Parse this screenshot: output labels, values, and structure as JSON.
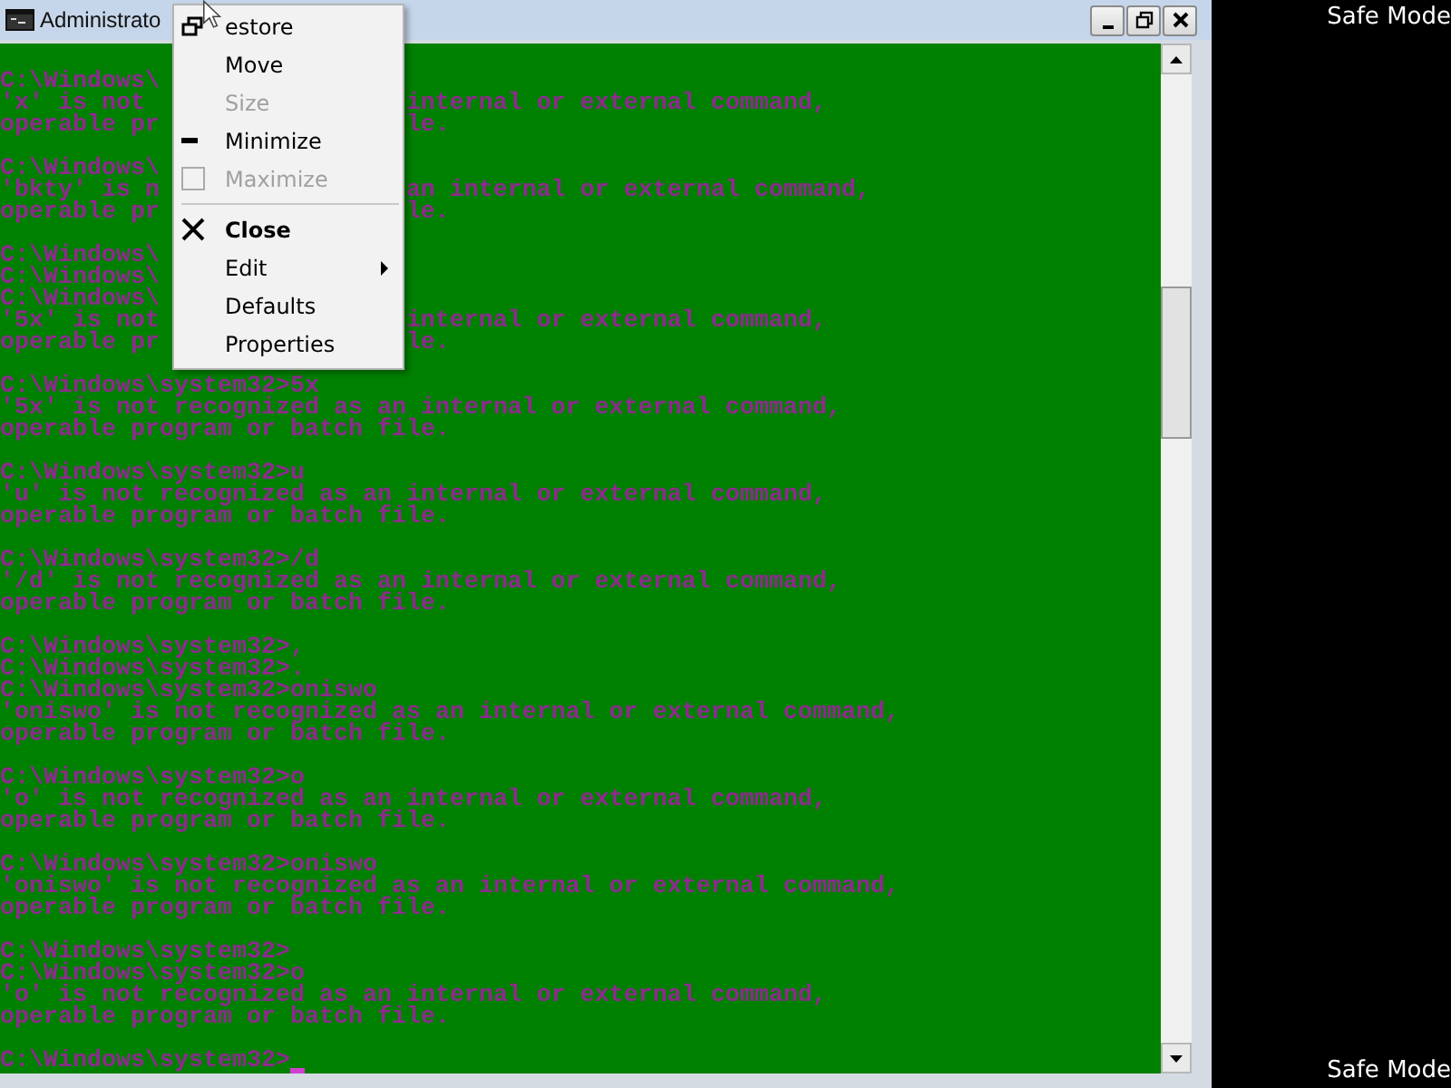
{
  "window": {
    "title": "Administrato"
  },
  "console": {
    "lines": [
      {
        "kind": "text",
        "text": "C:\\Windows\\"
      },
      {
        "kind": "text",
        "text": "'x' is not",
        "right": "internal or external command,"
      },
      {
        "kind": "text",
        "text": "operable pr",
        "right": "le."
      },
      {
        "kind": "blank"
      },
      {
        "kind": "text",
        "text": "C:\\Windows\\"
      },
      {
        "kind": "text",
        "text": "'bkty' is n",
        "right": "an internal or external command,"
      },
      {
        "kind": "text",
        "text": "operable pr",
        "right": "le."
      },
      {
        "kind": "blank"
      },
      {
        "kind": "text",
        "text": "C:\\Windows\\"
      },
      {
        "kind": "text",
        "text": "C:\\Windows\\"
      },
      {
        "kind": "text",
        "text": "C:\\Windows\\"
      },
      {
        "kind": "text",
        "text": "'5x' is not",
        "right": "internal or external command,"
      },
      {
        "kind": "text",
        "text": "operable pr",
        "right": "le."
      },
      {
        "kind": "blank"
      },
      {
        "kind": "text",
        "text": "C:\\Windows\\system32>5x"
      },
      {
        "kind": "text",
        "text": "'5x' is not recognized as an internal or external command,"
      },
      {
        "kind": "text",
        "text": "operable program or batch file."
      },
      {
        "kind": "blank"
      },
      {
        "kind": "text",
        "text": "C:\\Windows\\system32>u"
      },
      {
        "kind": "text",
        "text": "'u' is not recognized as an internal or external command,"
      },
      {
        "kind": "text",
        "text": "operable program or batch file."
      },
      {
        "kind": "blank"
      },
      {
        "kind": "text",
        "text": "C:\\Windows\\system32>/d"
      },
      {
        "kind": "text",
        "text": "'/d' is not recognized as an internal or external command,"
      },
      {
        "kind": "text",
        "text": "operable program or batch file."
      },
      {
        "kind": "blank"
      },
      {
        "kind": "text",
        "text": "C:\\Windows\\system32>,"
      },
      {
        "kind": "text",
        "text": "C:\\Windows\\system32>."
      },
      {
        "kind": "text",
        "text": "C:\\Windows\\system32>oniswo"
      },
      {
        "kind": "text",
        "text": "'oniswo' is not recognized as an internal or external command,"
      },
      {
        "kind": "text",
        "text": "operable program or batch file."
      },
      {
        "kind": "blank"
      },
      {
        "kind": "text",
        "text": "C:\\Windows\\system32>o"
      },
      {
        "kind": "text",
        "text": "'o' is not recognized as an internal or external command,"
      },
      {
        "kind": "text",
        "text": "operable program or batch file."
      },
      {
        "kind": "blank"
      },
      {
        "kind": "text",
        "text": "C:\\Windows\\system32>oniswo"
      },
      {
        "kind": "text",
        "text": "'oniswo' is not recognized as an internal or external command,"
      },
      {
        "kind": "text",
        "text": "operable program or batch file."
      },
      {
        "kind": "blank"
      },
      {
        "kind": "text",
        "text": "C:\\Windows\\system32>"
      },
      {
        "kind": "text",
        "text": "C:\\Windows\\system32>o"
      },
      {
        "kind": "text",
        "text": "'o' is not recognized as an internal or external command,"
      },
      {
        "kind": "text",
        "text": "operable program or batch file."
      },
      {
        "kind": "blank"
      },
      {
        "kind": "text",
        "text": "C:\\Windows\\system32>",
        "cursor": true
      }
    ]
  },
  "system_menu": {
    "items": [
      {
        "kind": "restore",
        "label": "estore",
        "disabled": false,
        "default": false
      },
      {
        "kind": "plain",
        "label": "Move",
        "disabled": false,
        "default": false
      },
      {
        "kind": "plain",
        "label": "Size",
        "disabled": true,
        "default": false
      },
      {
        "kind": "minimize",
        "label": "Minimize",
        "disabled": false,
        "default": false
      },
      {
        "kind": "maximize",
        "label": "Maximize",
        "disabled": true,
        "default": false
      },
      {
        "kind": "separator"
      },
      {
        "kind": "close",
        "label": "Close",
        "disabled": false,
        "default": true
      },
      {
        "kind": "submenu",
        "label": "Edit",
        "disabled": false,
        "default": false
      },
      {
        "kind": "plain",
        "label": "Defaults",
        "disabled": false,
        "default": false
      },
      {
        "kind": "plain",
        "label": "Properties",
        "disabled": false,
        "default": false
      }
    ]
  },
  "desktop": {
    "top_label": "Safe Mode",
    "bottom_label": "Safe Mode"
  }
}
